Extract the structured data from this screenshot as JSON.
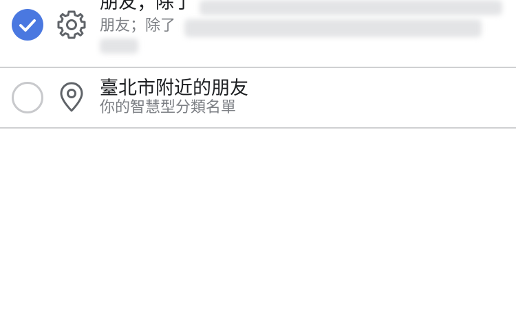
{
  "lists": [
    {
      "title": "朋友；除了",
      "subtitle": "朋友；除了",
      "checked": true,
      "icon": "gear-icon"
    },
    {
      "title": "臺北市附近的朋友",
      "subtitle": "你的智慧型分類名單",
      "checked": false,
      "icon": "location-pin-icon"
    }
  ],
  "colors": {
    "accent": "#4a78e0",
    "divider": "#cfd0d2",
    "title": "#1c1e21",
    "subtitle": "#7c7f84",
    "radio_unchecked": "#c8c9cc",
    "icon": "#5f6368"
  }
}
